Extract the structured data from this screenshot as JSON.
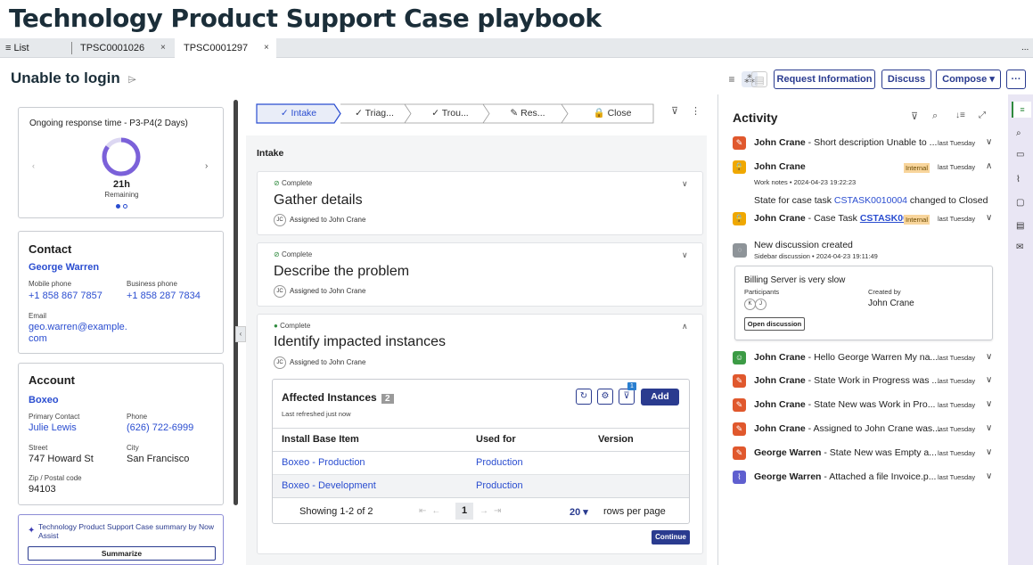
{
  "page_title": "Technology Product Support Case playbook",
  "tabs": {
    "list_label": "≡ List",
    "tab1": "TPSC0001026",
    "tab2": "TPSC0001297",
    "close": "×",
    "more": "..."
  },
  "case": {
    "title": "Unable to login",
    "buttons": {
      "request_info": "Request Information",
      "discuss": "Discuss",
      "compose": "Compose ▾",
      "more": "···"
    }
  },
  "response": {
    "title": "Ongoing response time - P3-P4(2 Days)",
    "remaining_value": "21h",
    "remaining_label": "Remaining",
    "progress_fraction": 0.85
  },
  "contact": {
    "heading": "Contact",
    "name": "George Warren",
    "mobile_label": "Mobile phone",
    "mobile": "+1 858 867 7857",
    "business_label": "Business phone",
    "business": "+1 858 287 7834",
    "email_label": "Email",
    "email_line1": "geo.warren@example.",
    "email_line2": "com"
  },
  "account": {
    "heading": "Account",
    "name": "Boxeo",
    "primary_label": "Primary Contact",
    "primary": "Julie Lewis",
    "phone_label": "Phone",
    "phone": "(626) 722-6999",
    "street_label": "Street",
    "street": "747 Howard St",
    "city_label": "City",
    "city": "San Francisco",
    "zip_label": "Zip / Postal code",
    "zip": "94103"
  },
  "assist": {
    "text": "Technology Product Support Case summary by Now Assist",
    "button": "Summarize"
  },
  "stepper": {
    "steps": [
      "✓ Intake",
      "✓ Triag...",
      "✓ Trou...",
      "✎ Res...",
      "🔒 Close"
    ]
  },
  "intake_label": "Intake",
  "tasks": [
    {
      "status": "Complete",
      "title": "Gather details",
      "assigned": "Assigned to John Crane",
      "initials": "JC"
    },
    {
      "status": "Complete",
      "title": "Describe the problem",
      "assigned": "Assigned to John Crane",
      "initials": "JC"
    },
    {
      "status": "Complete",
      "title": "Identify impacted instances",
      "assigned": "Assigned to John Crane",
      "initials": "JC"
    }
  ],
  "affected": {
    "title": "Affected Instances",
    "count": "2",
    "refreshed": "Last refreshed just now",
    "filter_badge": "1",
    "add": "Add",
    "columns": [
      "Install Base Item",
      "Used for",
      "Version"
    ],
    "rows": [
      {
        "item": "Boxeo - Production",
        "used_for": "Production",
        "version": ""
      },
      {
        "item": "Boxeo - Development",
        "used_for": "Production",
        "version": ""
      }
    ],
    "showing": "Showing 1-2 of 2",
    "page": "1",
    "per_page": "20 ▾",
    "per_page_label": "rows per page",
    "continue": "Continue"
  },
  "activity": {
    "title": "Activity",
    "items": [
      {
        "icon": "pencil",
        "color": "#e0582d",
        "name": "John Crane",
        "text": " - Short description Unable to ...",
        "time": "last Tuesday",
        "chev": "∨"
      },
      {
        "icon": "lock",
        "color": "#f0a800",
        "name": "John Crane",
        "text": "",
        "time": "last Tuesday",
        "chev": "∧",
        "badge": "Internal"
      },
      {
        "icon": "lock",
        "color": "#f0a800",
        "name": "John Crane",
        "text": " - Case Task ",
        "link": "CSTASK00...",
        "time": "last Tuesday",
        "chev": "∨",
        "badge": "Internal"
      },
      {
        "icon": "people",
        "color": "#3c9b45",
        "name": "John Crane",
        "text": " - Hello George Warren My na...",
        "time": "last Tuesday",
        "chev": "∨"
      },
      {
        "icon": "pencil",
        "color": "#e0582d",
        "name": "John Crane",
        "text": " - State Work in Progress was ...",
        "time": "last Tuesday",
        "chev": "∨"
      },
      {
        "icon": "pencil",
        "color": "#e0582d",
        "name": "John Crane",
        "text": " - State New was Work in Pro...",
        "time": "last Tuesday",
        "chev": "∨"
      },
      {
        "icon": "pencil",
        "color": "#e0582d",
        "name": "John Crane",
        "text": " - Assigned to John Crane was...",
        "time": "last Tuesday",
        "chev": "∨"
      },
      {
        "icon": "pencil",
        "color": "#e0582d",
        "name": "George Warren",
        "text": " - State New was Empty a...",
        "time": "last Tuesday",
        "chev": "∨"
      },
      {
        "icon": "paperclip",
        "color": "#5f5fcf",
        "name": "George Warren",
        "text": " - Attached a file Invoice.p...",
        "time": "last Tuesday",
        "chev": "∨"
      }
    ],
    "work_notes_meta": "Work notes • 2024-04-23 19:22:23",
    "state_text": "State for case task ",
    "state_link": "CSTASK0010004",
    "state_suffix": " changed to Closed",
    "discussion_title": "New discussion created",
    "discussion_meta": "Sidebar discussion • 2024-04-23 19:11:49",
    "discussion_card": {
      "title": "Billing Server is very slow",
      "participants_label": "Participants",
      "participants": [
        "K",
        "J"
      ],
      "created_label": "Created by",
      "created_by": "John Crane",
      "button": "Open discussion"
    }
  }
}
